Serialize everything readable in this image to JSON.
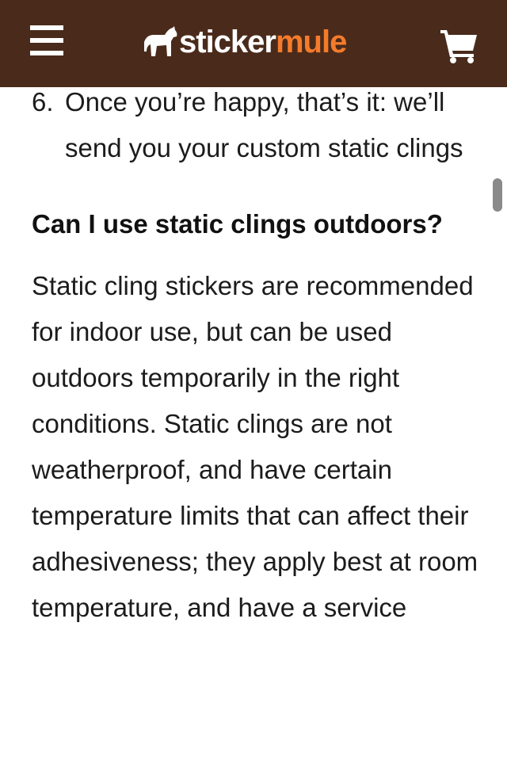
{
  "header": {
    "menu_icon": "hamburger-menu-icon",
    "logo": {
      "part1": "sticker",
      "part2": "mule",
      "icon": "horse-logo-icon"
    },
    "cart_icon": "shopping-cart-icon"
  },
  "content": {
    "step": {
      "number": "6.",
      "text": "Once you’re happy, that’s it: we’ll send you your custom static clings"
    },
    "faq": {
      "question": "Can I use static clings outdoors?",
      "answer": "Static cling stickers are recommended for indoor use, but can be used outdoors temporarily in the right conditions. Static clings are not weatherproof, and have certain temperature limits that can affect their adhesiveness; they apply best at room temperature, and have a service"
    }
  },
  "colors": {
    "header_bg": "#4a2b1b",
    "logo_primary": "#ffffff",
    "logo_accent": "#f47b2b",
    "text": "#1c1c1c"
  }
}
